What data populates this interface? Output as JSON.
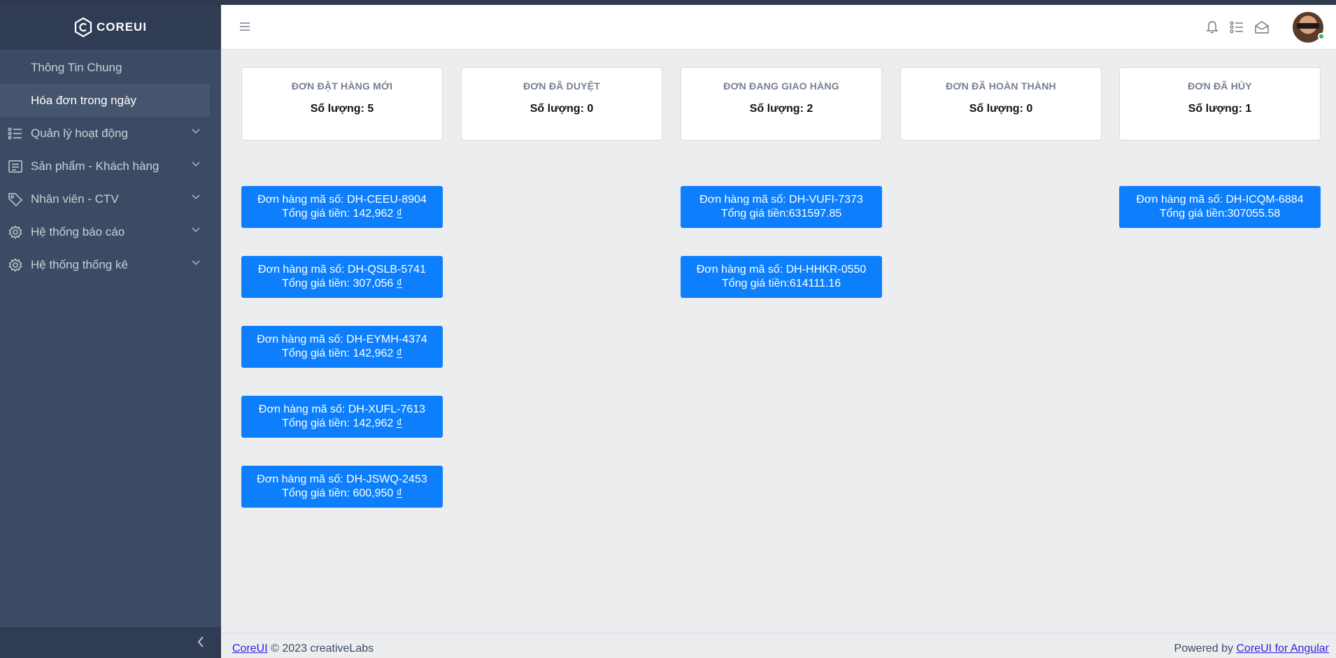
{
  "brand": {
    "text": "COREUI"
  },
  "sidebar": {
    "items": [
      {
        "label": "Thông Tin Chung"
      },
      {
        "label": "Hóa đơn trong ngày"
      },
      {
        "label": "Quản lý hoạt động",
        "icon": "list-icon"
      },
      {
        "label": "Sản phẩm - Khách hàng",
        "icon": "document-icon"
      },
      {
        "label": "Nhân viên - CTV",
        "icon": "tag-icon"
      },
      {
        "label": "Hệ thống báo cáo",
        "icon": "gear-icon"
      },
      {
        "label": "Hệ thống thống kê",
        "icon": "gear-icon"
      }
    ]
  },
  "status": [
    {
      "title": "ĐƠN ĐẶT HÀNG MỚI",
      "count": "Số lượng: 5"
    },
    {
      "title": "ĐƠN ĐÃ DUYỆT",
      "count": "Số lượng: 0"
    },
    {
      "title": "ĐƠN ĐANG GIAO HÀNG",
      "count": "Số lượng: 2"
    },
    {
      "title": "ĐƠN ĐÃ HOÀN THÀNH",
      "count": "Số lượng: 0"
    },
    {
      "title": "ĐƠN ĐÃ HỦY",
      "count": "Số lượng: 1"
    }
  ],
  "orders": {
    "new": [
      {
        "code": "Đơn hàng mã số: DH-CEEU-8904",
        "total": "Tổng giá tiền: 142,962 ",
        "currency": "₫"
      },
      {
        "code": "Đơn hàng mã số: DH-QSLB-5741",
        "total": "Tổng giá tiền: 307,056 ",
        "currency": "₫"
      },
      {
        "code": "Đơn hàng mã số: DH-EYMH-4374",
        "total": "Tổng giá tiền: 142,962 ",
        "currency": "₫"
      },
      {
        "code": "Đơn hàng mã số: DH-XUFL-7613",
        "total": "Tổng giá tiền: 142,962 ",
        "currency": "₫"
      },
      {
        "code": "Đơn hàng mã số: DH-JSWQ-2453",
        "total": "Tổng giá tiền: 600,950 ",
        "currency": "₫"
      }
    ],
    "delivering": [
      {
        "code": "Đơn hàng mã số: DH-VUFI-7373",
        "total": "Tổng giá tiền:631597.85"
      },
      {
        "code": "Đơn hàng mã số: DH-HHKR-0550",
        "total": "Tổng giá tiền:614111.16"
      }
    ],
    "cancelled": [
      {
        "code": "Đơn hàng mã số: DH-ICQM-6884",
        "total": "Tổng giá tiền:307055.58"
      }
    ]
  },
  "footer": {
    "left_link": "CoreUI",
    "left_text": " © 2023 creativeLabs",
    "right_text": "Powered by ",
    "right_link": "CoreUI for Angular"
  },
  "colors": {
    "sidebar": "#3c4b64",
    "accent": "#0d7ffd",
    "status_online": "#2eb85c"
  }
}
